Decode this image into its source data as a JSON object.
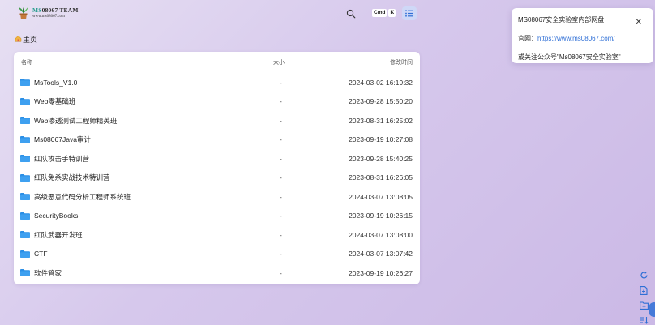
{
  "header": {
    "logo_title": "MS08067 TEAM",
    "logo_subtitle": "www.ms08067.com",
    "search_icon": "search-icon",
    "shortcut_keys": [
      "Cmd",
      "K"
    ],
    "view_toggle_icon": "list-view-icon"
  },
  "breadcrumb": {
    "icon": "home-icon",
    "label": "主页"
  },
  "notice": {
    "title": "MS08067安全实验室内部网盘",
    "site_label": "官网：",
    "site_url": "https://www.ms08067.com/",
    "follow_text": "或关注公众号\"Ms08067安全实验室\"",
    "close_icon": "close-icon"
  },
  "table": {
    "headers": {
      "name": "名称",
      "size": "大小",
      "modified": "修改时间"
    },
    "rows": [
      {
        "name": "MsTools_V1.0",
        "size": "-",
        "modified": "2024-03-02 16:19:32"
      },
      {
        "name": "Web零基础班",
        "size": "-",
        "modified": "2023-09-28 15:50:20"
      },
      {
        "name": "Web渗透测试工程师精英班",
        "size": "-",
        "modified": "2023-08-31 16:25:02"
      },
      {
        "name": "Ms08067Java审计",
        "size": "-",
        "modified": "2023-09-19 10:27:08"
      },
      {
        "name": "红队攻击手特训营",
        "size": "-",
        "modified": "2023-09-28 15:40:25"
      },
      {
        "name": "红队免杀实战技术特训营",
        "size": "-",
        "modified": "2023-08-31 16:26:05"
      },
      {
        "name": "高级恶意代码分析工程师系统班",
        "size": "-",
        "modified": "2024-03-07 13:08:05"
      },
      {
        "name": "SecurityBooks",
        "size": "-",
        "modified": "2023-09-19 10:26:15"
      },
      {
        "name": "红队武器开发班",
        "size": "-",
        "modified": "2024-03-07 13:08:00"
      },
      {
        "name": "CTF",
        "size": "-",
        "modified": "2024-03-07 13:07:42"
      },
      {
        "name": "软件管家",
        "size": "-",
        "modified": "2023-09-19 10:26:27"
      }
    ]
  },
  "tools": [
    "refresh-icon",
    "new-file-icon",
    "new-folder-icon",
    "sort-icon"
  ],
  "colors": {
    "accent": "#2f6fd6",
    "folder": "#2b8fe6",
    "background": "#d6c8ec"
  }
}
